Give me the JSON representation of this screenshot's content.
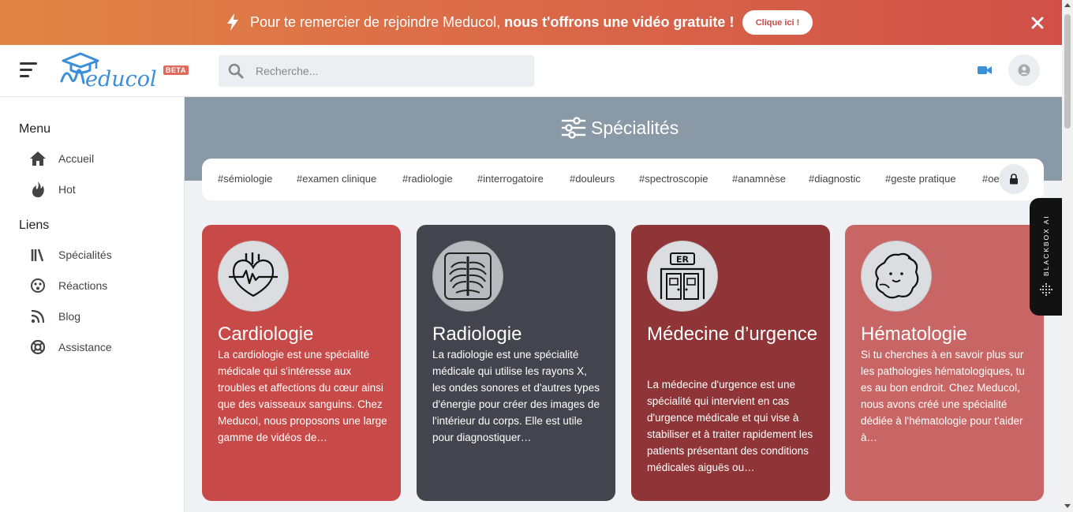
{
  "banner": {
    "message_part1": "Pour te remercier de rejoindre Meducol, ",
    "message_part2": "nous t'offrons une vidéo gratuite !",
    "cta_label": "Clique ici !",
    "bolt_icon": "lightning-icon",
    "close_icon": "close-icon",
    "gradient": [
      "#e08544",
      "#d05048"
    ]
  },
  "header": {
    "logo_text": "Meducol",
    "beta_label": "BETA",
    "search_placeholder": "Recherche...",
    "video_icon": "video-camera-icon",
    "avatar_icon": "user-icon",
    "accent": "#3a8fd8"
  },
  "sidebar": {
    "menu_title": "Menu",
    "menu_items": [
      {
        "label": "Accueil",
        "icon": "home-icon"
      },
      {
        "label": "Hot",
        "icon": "fire-icon"
      }
    ],
    "links_title": "Liens",
    "link_items": [
      {
        "label": "Spécialités",
        "icon": "books-icon"
      },
      {
        "label": "Réactions",
        "icon": "face-icon"
      },
      {
        "label": "Blog",
        "icon": "rss-icon"
      },
      {
        "label": "Assistance",
        "icon": "lifebuoy-icon"
      }
    ]
  },
  "main": {
    "section_title": "Spécialités",
    "section_icon": "sliders-icon",
    "tags": [
      "#sémiologie",
      "#examen clinique",
      "#radiologie",
      "#interrogatoire",
      "#douleurs",
      "#spectroscopie",
      "#anamnèse",
      "#diagnostic",
      "#geste pratique",
      "#oeil"
    ],
    "tags_button_icon": "lock-icon",
    "cards": [
      {
        "title": "Cardiologie",
        "description": "La cardiologie est une spécialité médicale qui s'intéresse aux troubles et affections du cœur ainsi que des vaisseaux sanguins. Chez Meducol, nous proposons une large gamme de vidéos de…",
        "icon": "heart-icon",
        "color": "#c84a48"
      },
      {
        "title": "Radiologie",
        "description": "La radiologie est une spécialité médicale qui utilise les rayons X, les ondes sonores et d'autres types d'énergie pour créer des images de l'intérieur du corps. Elle est utile pour diagnostiquer…",
        "icon": "xray-icon",
        "color": "#44444f"
      },
      {
        "title": "Médecine d’urgence",
        "description": "La médecine d'urgence est une spécialité qui intervient en cas d'urgence médicale et qui vise à stabiliser et à traiter rapidement les patients présentant des conditions médicales aiguës ou…",
        "icon": "emergency-room-icon",
        "color": "#8f3537"
      },
      {
        "title": "Hématologie",
        "description": "Si tu cherches à en savoir plus sur les pathologies hématologiques, tu es au bon endroit. Chez Meducol, nous avons créé une spécialité dédiée à l'hématologie pour t'aider à…",
        "icon": "blood-cell-icon",
        "color": "#c76664"
      }
    ]
  },
  "blackbox": {
    "label": "BLACKBOX AI"
  }
}
